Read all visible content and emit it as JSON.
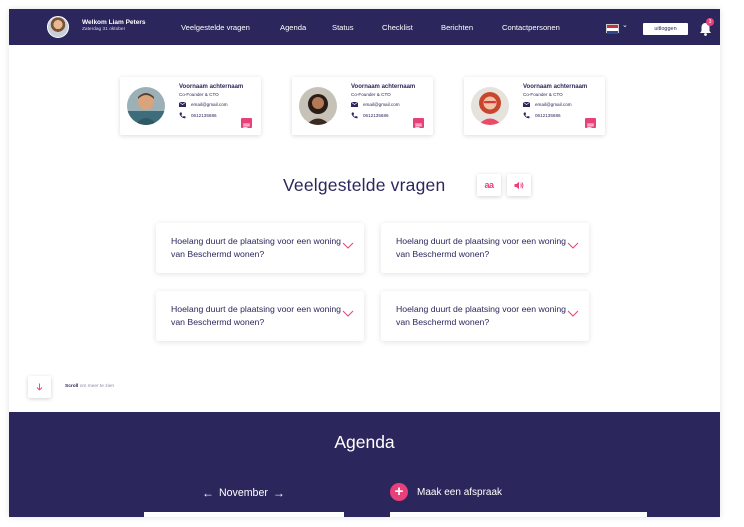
{
  "header": {
    "welcome": "Welkom Liam Peters",
    "date": "Zaterdag 31 oktober",
    "nav": [
      "Veelgestelde vragen",
      "Agenda",
      "Status",
      "Checklist",
      "Berichten",
      "Contactpersonen"
    ],
    "language_flag": "nl-flag-icon",
    "logout_label": "uitloggen",
    "notification_count": "3"
  },
  "contacts": [
    {
      "name": "Voornaam achternaam",
      "role": "Co-Founder & CTO",
      "email": "email@gmail.com",
      "phone": "0612135686"
    },
    {
      "name": "Voornaam achternaam",
      "role": "Co-Founder & CTO",
      "email": "email@gmail.com",
      "phone": "0612135686"
    },
    {
      "name": "Voornaam achternaam",
      "role": "Co-Founder & CTO",
      "email": "email@gmail.com",
      "phone": "0612135686"
    }
  ],
  "faq": {
    "title": "Veelgestelde vragen",
    "text_size_label": "aa",
    "questions": [
      "Hoelang duurt de plaatsing voor een woning van Beschermd wonen?",
      "Hoelang duurt de plaatsing voor een woning van Beschermd wonen?",
      "Hoelang duurt de plaatsing voor een woning van Beschermd wonen?",
      "Hoelang duurt de plaatsing voor een woning van Beschermd wonen?"
    ]
  },
  "scroll_hint": {
    "bold": "Scroll",
    "rest": "om meer te zien"
  },
  "agenda": {
    "title": "Agenda",
    "month": "November",
    "appointment_label": "Maak een afspraak"
  },
  "colors": {
    "primary": "#2b275c",
    "accent": "#e8407a"
  }
}
